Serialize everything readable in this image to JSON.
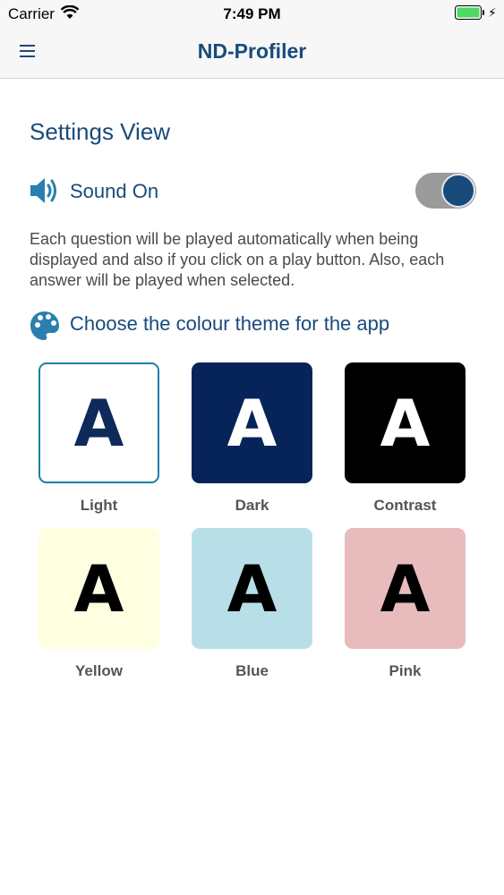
{
  "status_bar": {
    "carrier": "Carrier",
    "time": "7:49 PM"
  },
  "nav": {
    "title": "ND-Profiler"
  },
  "settings": {
    "title": "Settings View",
    "sound_label": "Sound On",
    "sound_on": true,
    "description": "Each question will be played automatically when being displayed and also if you click on a play button. Also, each answer will be played when selected.",
    "theme_heading": "Choose the colour theme for the app"
  },
  "themes": [
    {
      "letter": "A",
      "name": "Light",
      "bg": "#ffffff",
      "fg": "#0d2a5a",
      "border": "#1a7fa8",
      "selected": true
    },
    {
      "letter": "A",
      "name": "Dark",
      "bg": "#062459",
      "fg": "#ffffff"
    },
    {
      "letter": "A",
      "name": "Contrast",
      "bg": "#000000",
      "fg": "#ffffff"
    },
    {
      "letter": "A",
      "name": "Yellow",
      "bg": "#fdffe0",
      "fg": "#000000"
    },
    {
      "letter": "A",
      "name": "Blue",
      "bg": "#b8dfe8",
      "fg": "#000000"
    },
    {
      "letter": "A",
      "name": "Pink",
      "bg": "#e8bcbd",
      "fg": "#000000"
    }
  ],
  "colors": {
    "primary": "#1a4a7a",
    "toggle_track": "#9a9a9a",
    "icon_blue": "#2a7fb0"
  }
}
